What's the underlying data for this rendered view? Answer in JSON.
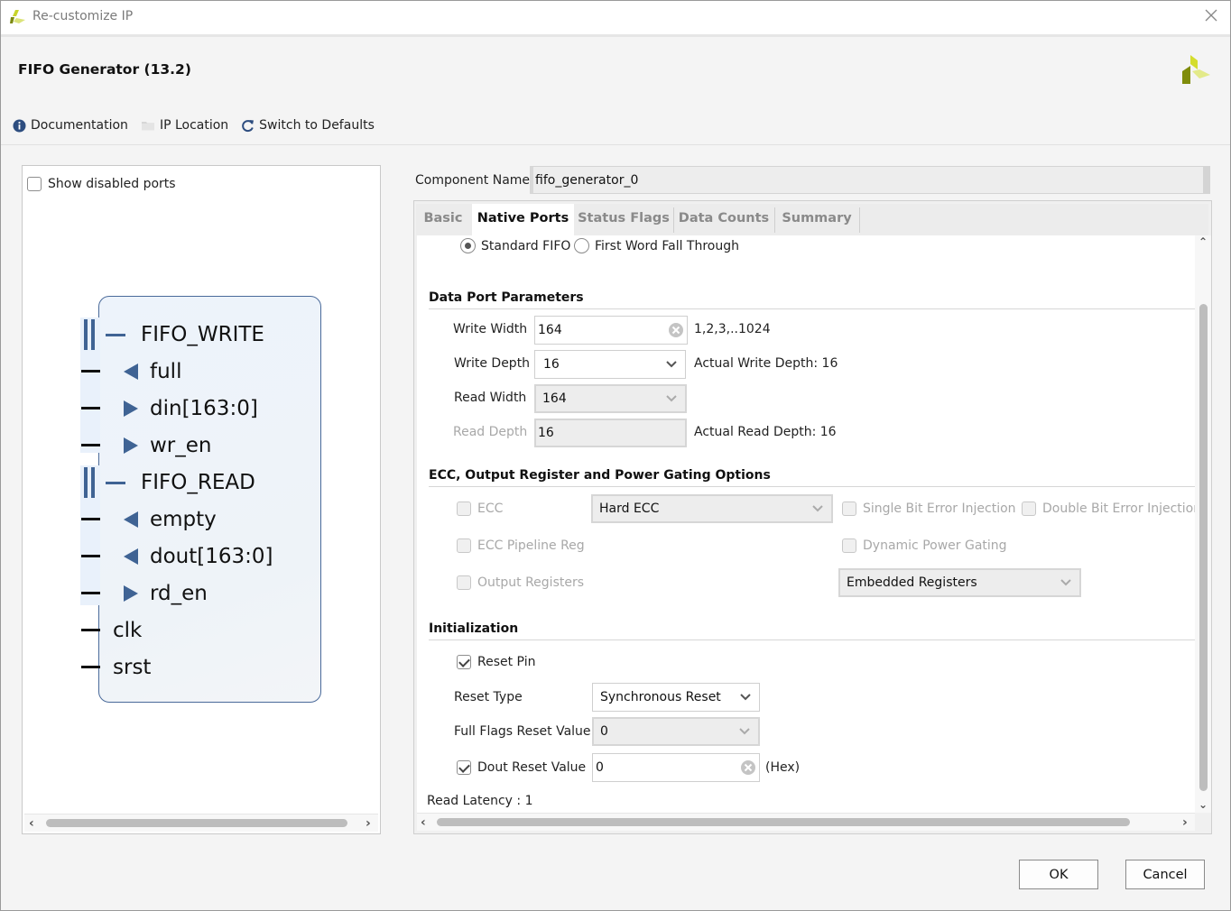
{
  "window": {
    "title": "Re-customize IP",
    "close_icon": "close-icon"
  },
  "header": {
    "title": "FIFO Generator (13.2)",
    "logo_icon": "xilinx-logo-icon"
  },
  "toolbar": {
    "items": [
      {
        "label": "Documentation",
        "icon": "info-icon"
      },
      {
        "label": "IP Location",
        "icon": "folder-icon"
      },
      {
        "label": "Switch to Defaults",
        "icon": "refresh-icon"
      }
    ]
  },
  "symbol_panel": {
    "show_disabled_ports_label": "Show disabled ports",
    "show_disabled_ports_checked": false,
    "groups": [
      {
        "name": "FIFO_WRITE",
        "ports": [
          {
            "name": "full",
            "direction": "out"
          },
          {
            "name": "din[163:0]",
            "direction": "in"
          },
          {
            "name": "wr_en",
            "direction": "in"
          }
        ]
      },
      {
        "name": "FIFO_READ",
        "ports": [
          {
            "name": "empty",
            "direction": "out"
          },
          {
            "name": "dout[163:0]",
            "direction": "out"
          },
          {
            "name": "rd_en",
            "direction": "in"
          }
        ]
      }
    ],
    "single_ports": [
      "clk",
      "srst"
    ]
  },
  "component": {
    "label": "Component Name",
    "value": "fifo_generator_0"
  },
  "tabs": [
    {
      "label": "Basic",
      "active": false
    },
    {
      "label": "Native Ports",
      "active": true
    },
    {
      "label": "Status Flags",
      "active": false
    },
    {
      "label": "Data Counts",
      "active": false
    },
    {
      "label": "Summary",
      "active": false
    }
  ],
  "read_mode": {
    "options": [
      "Standard FIFO",
      "First Word Fall Through"
    ],
    "selected": "Standard FIFO"
  },
  "data_port": {
    "title": "Data Port Parameters",
    "write_width": {
      "label": "Write Width",
      "value": "164",
      "hint": "1,2,3,..1024"
    },
    "write_depth": {
      "label": "Write Depth",
      "value": "16",
      "hint": "Actual Write Depth: 16"
    },
    "read_width": {
      "label": "Read Width",
      "value": "164"
    },
    "read_depth": {
      "label": "Read Depth",
      "value": "16",
      "hint": "Actual Read Depth: 16"
    }
  },
  "ecc": {
    "title": "ECC, Output Register and Power Gating Options",
    "ecc_label": "ECC",
    "ecc_checked": false,
    "ecc_type": "Hard ECC",
    "single_bit_label": "Single Bit Error Injection",
    "double_bit_label": "Double Bit Error Injection",
    "ecc_pipeline_label": "ECC Pipeline Reg",
    "dynamic_power_label": "Dynamic Power Gating",
    "output_registers_label": "Output Registers",
    "output_register_type": "Embedded Registers"
  },
  "init": {
    "title": "Initialization",
    "reset_pin_label": "Reset Pin",
    "reset_pin_checked": true,
    "reset_type_label": "Reset Type",
    "reset_type": "Synchronous Reset",
    "full_flags_label": "Full Flags Reset Value",
    "full_flags_value": "0",
    "dout_reset_label": "Dout Reset Value",
    "dout_reset_checked": true,
    "dout_reset_value": "0",
    "dout_reset_suffix": "(Hex)",
    "read_latency": "Read Latency : 1"
  },
  "buttons": {
    "ok": "OK",
    "cancel": "Cancel"
  }
}
